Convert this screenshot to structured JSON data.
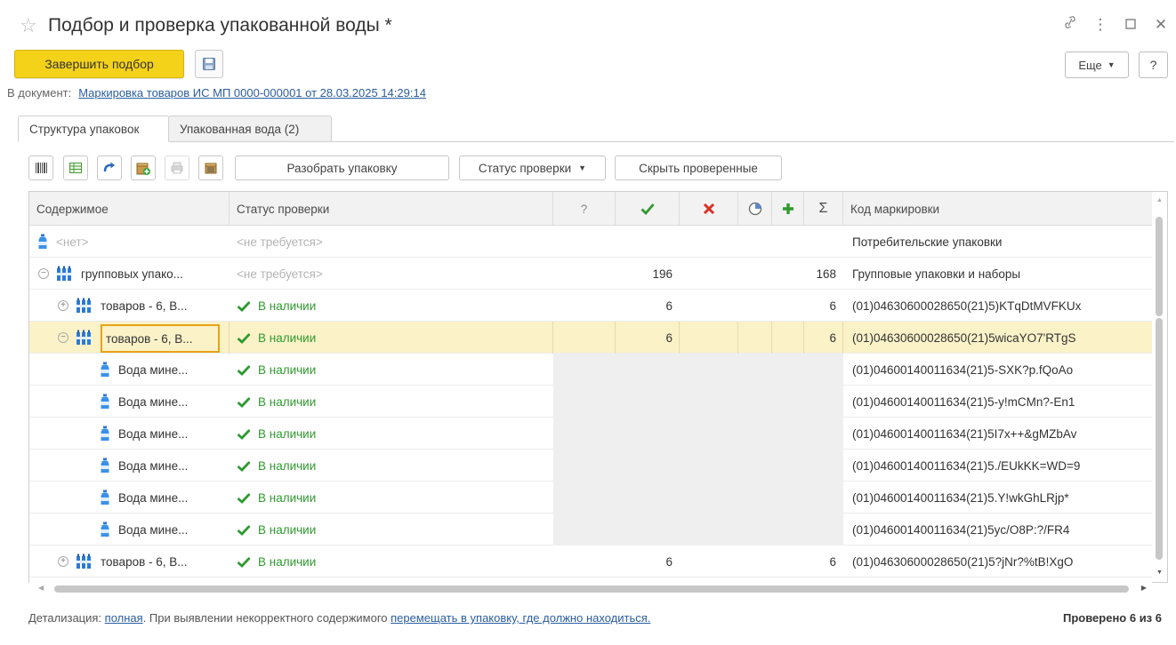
{
  "window": {
    "title": "Подбор и проверка упакованной воды *",
    "icons": [
      "link-icon",
      "more-vert-icon",
      "maximize-icon",
      "close-icon"
    ]
  },
  "toolbar": {
    "finish_label": "Завершить подбор",
    "more_label": "Еще",
    "help_label": "?"
  },
  "document": {
    "label": "В документ:",
    "link": "Маркировка товаров ИС МП 0000-000001 от 28.03.2025 14:29:14"
  },
  "tabs": [
    {
      "label": "Структура упаковок",
      "active": true
    },
    {
      "label": "Упакованная вода (2)",
      "active": false
    }
  ],
  "inner_toolbar": {
    "unpack_label": "Разобрать упаковку",
    "status_label": "Статус проверки",
    "hide_label": "Скрыть проверенные"
  },
  "table": {
    "columns": {
      "content": "Содержимое",
      "status": "Статус проверки",
      "question": "?",
      "sum": "Σ",
      "code": "Код маркировки"
    },
    "rows": [
      {
        "content": "<нет>",
        "status": "<не требуется>",
        "count": "",
        "sum": "",
        "code": "Потребительские упаковки"
      },
      {
        "content": "групповых упако...",
        "status": "<не требуется>",
        "count": "196",
        "sum": "168",
        "code": "Групповые упаковки и наборы"
      },
      {
        "content": "товаров - 6, В...",
        "status": "В наличии",
        "count": "6",
        "sum": "6",
        "code": "(01)04630600028650(21)5)KTqDtMVFKUx"
      },
      {
        "content": "товаров - 6, В...",
        "status": "В наличии",
        "count": "6",
        "sum": "6",
        "code": "(01)04630600028650(21)5wicaYO7'RTgS"
      },
      {
        "content": "Вода мине...",
        "status": "В наличии",
        "count": "",
        "sum": "",
        "code": "(01)04600140011634(21)5-SXK?p.fQoAo"
      },
      {
        "content": "Вода мине...",
        "status": "В наличии",
        "count": "",
        "sum": "",
        "code": "(01)04600140011634(21)5-y!mCMn?-En1"
      },
      {
        "content": "Вода мине...",
        "status": "В наличии",
        "count": "",
        "sum": "",
        "code": "(01)04600140011634(21)5I7x++&gMZbAv"
      },
      {
        "content": "Вода мине...",
        "status": "В наличии",
        "count": "",
        "sum": "",
        "code": "(01)04600140011634(21)5./EUkKK=WD=9"
      },
      {
        "content": "Вода мине...",
        "status": "В наличии",
        "count": "",
        "sum": "",
        "code": "(01)04600140011634(21)5.Y!wkGhLRjp*"
      },
      {
        "content": "Вода мине...",
        "status": "В наличии",
        "count": "",
        "sum": "",
        "code": "(01)04600140011634(21)5yc/O8P:?/FR4"
      },
      {
        "content": "товаров - 6, В...",
        "status": "В наличии",
        "count": "6",
        "sum": "6",
        "code": "(01)04630600028650(21)5?jNr?%tB!XgO"
      }
    ]
  },
  "footer": {
    "detail_label": "Детализация:",
    "detail_link": "полная",
    "text": ". При выявлении некорректного содержимого",
    "move_link": "перемещать в упаковку, где должно находиться.",
    "checked": "Проверено 6 из 6"
  },
  "colors": {
    "accent_yellow": "#f5d21a",
    "link_blue": "#2a5d9f",
    "status_green": "#2f9a2f",
    "selected_row": "#fbf2c8",
    "cross_red": "#d93025"
  }
}
